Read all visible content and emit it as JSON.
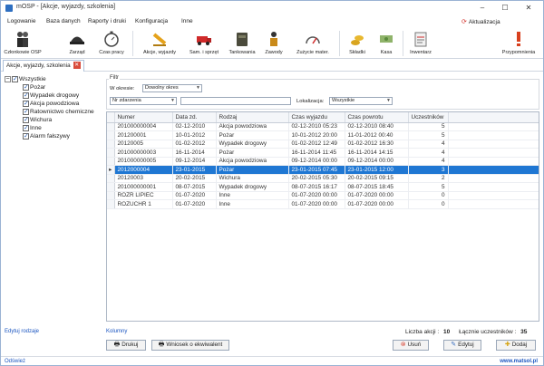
{
  "window": {
    "title": "mOSP - [Akcje, wyjazdy, szkolenia]"
  },
  "menu": [
    "Logowanie",
    "Baza danych",
    "Raporty i druki",
    "Konfiguracja",
    "Inne"
  ],
  "update_label": "Aktualizacja",
  "toolbar": [
    {
      "label": "Członkowie OSP",
      "icon": "firefighters-icon"
    },
    {
      "label": "Zarząd",
      "icon": "helmet-icon"
    },
    {
      "label": "Czas pracy",
      "icon": "stopwatch-icon"
    },
    {
      "label": "Akcje, wyjazdy",
      "icon": "siren-icon"
    },
    {
      "label": "Sam. i sprzęt",
      "icon": "fire-truck-icon"
    },
    {
      "label": "Tankowania",
      "icon": "fuel-can-icon"
    },
    {
      "label": "Zawody",
      "icon": "firefighter-icon"
    },
    {
      "label": "Zużycie mater.",
      "icon": "gauge-icon"
    },
    {
      "label": "Składki",
      "icon": "coins-icon"
    },
    {
      "label": "Kasa",
      "icon": "money-icon"
    },
    {
      "label": "Inwentarz",
      "icon": "clipboard-icon"
    },
    {
      "label": "Przypomnienia",
      "icon": "exclamation-icon"
    }
  ],
  "tab": {
    "label": "Akcje, wyjazdy, szkolenia"
  },
  "tree": {
    "root": "Wszystkie",
    "items": [
      "Pożar",
      "Wypadek drogowy",
      "Akcja powodziowa",
      "Ratownictwo chemiczne",
      "Wichura",
      "Inne",
      "Alarm fałszywy"
    ]
  },
  "filter": {
    "group_label": "Filtr",
    "period_label": "W okresie:",
    "period_value": "Dowolny okres",
    "number_value": "Nr zdarzenia",
    "number_input": "",
    "location_label": "Lokalizacja:",
    "location_value": "Wszystkie"
  },
  "table": {
    "columns": [
      "Numer",
      "Data zd.",
      "Rodzaj",
      "Czas wyjazdu",
      "Czas powrotu",
      "Uczestników"
    ],
    "rows": [
      [
        "201000000004",
        "02-12-2010",
        "Akcja powodziowa",
        "02-12-2010 05:23",
        "02-12-2010 08:40",
        "5"
      ],
      [
        "201200001",
        "10-01-2012",
        "Pożar",
        "10-01-2012 20:00",
        "11-01-2012 00:40",
        "5"
      ],
      [
        "20120005",
        "01-02-2012",
        "Wypadek drogowy",
        "01-02-2012 12:49",
        "01-02-2012 16:30",
        "4"
      ],
      [
        "201000000003",
        "16-11-2014",
        "Pożar",
        "16-11-2014 11:45",
        "16-11-2014 14:15",
        "4"
      ],
      [
        "201000000005",
        "09-12-2014",
        "Akcja powodziowa",
        "09-12-2014 00:00",
        "09-12-2014 00:00",
        "4"
      ],
      [
        "2012000004",
        "23-01-2015",
        "Pożar",
        "23-01-2015 07:45",
        "23-01-2015 12:00",
        "3"
      ],
      [
        "20120003",
        "20-02-2015",
        "Wichura",
        "20-02-2015 05:30",
        "20-02-2015 09:15",
        "2"
      ],
      [
        "201000000001",
        "08-07-2015",
        "Wypadek drogowy",
        "08-07-2015 16:17",
        "08-07-2015 18:45",
        "5"
      ],
      [
        "ROZR LIPIEC",
        "01-07-2020",
        "Inne",
        "01-07-2020 00:00",
        "01-07-2020 00:00",
        "0"
      ],
      [
        "ROZUCHR 1",
        "01-07-2020",
        "Inne",
        "01-07-2020 00:00",
        "01-07-2020 00:00",
        "0"
      ]
    ],
    "selected_index": 5
  },
  "edit_types_link": "Edytuj rodzaje",
  "columns_link": "Kolumny",
  "stats": {
    "actions_label": "Liczba akcji :",
    "actions_value": "10",
    "participants_label": "Łącznie uczestników :",
    "participants_value": "35"
  },
  "buttons": {
    "print": "Drukuj",
    "request": "Wniosek o ekwiwalent",
    "delete": "Usuń",
    "edit": "Edytuj",
    "add": "Dodaj"
  },
  "status": {
    "left": "Odśwież",
    "right": "www.matsol.pl"
  },
  "colors": {
    "selection": "#1f77d3",
    "link": "#1a55c0",
    "danger": "#d94c3c"
  }
}
